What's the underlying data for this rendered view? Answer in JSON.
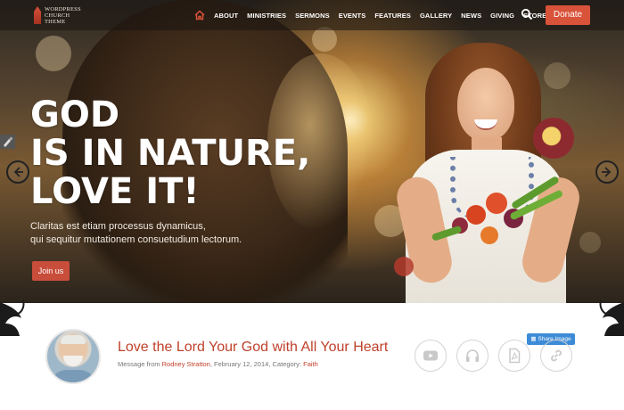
{
  "site": {
    "logo_line1": "WORDPRESS",
    "logo_line2": "CHURCH",
    "logo_line3": "THEME"
  },
  "nav": {
    "items": [
      "ABOUT",
      "MINISTRIES",
      "SERMONS",
      "EVENTS",
      "FEATURES",
      "GALLERY",
      "NEWS",
      "GIVING",
      "STORE"
    ],
    "donate_label": "Donate",
    "icons": [
      "home-icon",
      "search-icon"
    ]
  },
  "hero": {
    "headline_line1": "GOD",
    "headline_line2": "IS IN NATURE,",
    "headline_line3": "LOVE IT!",
    "subtext_line1": "Claritas est etiam processus dynamicus,",
    "subtext_line2": "qui sequitur mutationem consuetudium lectorum.",
    "cta_label": "Join us",
    "icons": [
      "chevron-left-icon",
      "chevron-right-icon",
      "paintbrush-icon"
    ]
  },
  "sermon": {
    "title": "Love the Lord Your God with All Your Heart",
    "meta_prefix": "Message from",
    "speaker": "Rodney Stratton",
    "date": "February 12, 2014",
    "category_label": "Category:",
    "category": "Faith",
    "share_label": "Share Image",
    "media_icons": [
      "youtube-icon",
      "headphones-icon",
      "pdf-icon",
      "link-icon"
    ]
  },
  "colors": {
    "accent": "#c0412c",
    "donate": "#d9523a",
    "share": "#3d8bd6"
  }
}
